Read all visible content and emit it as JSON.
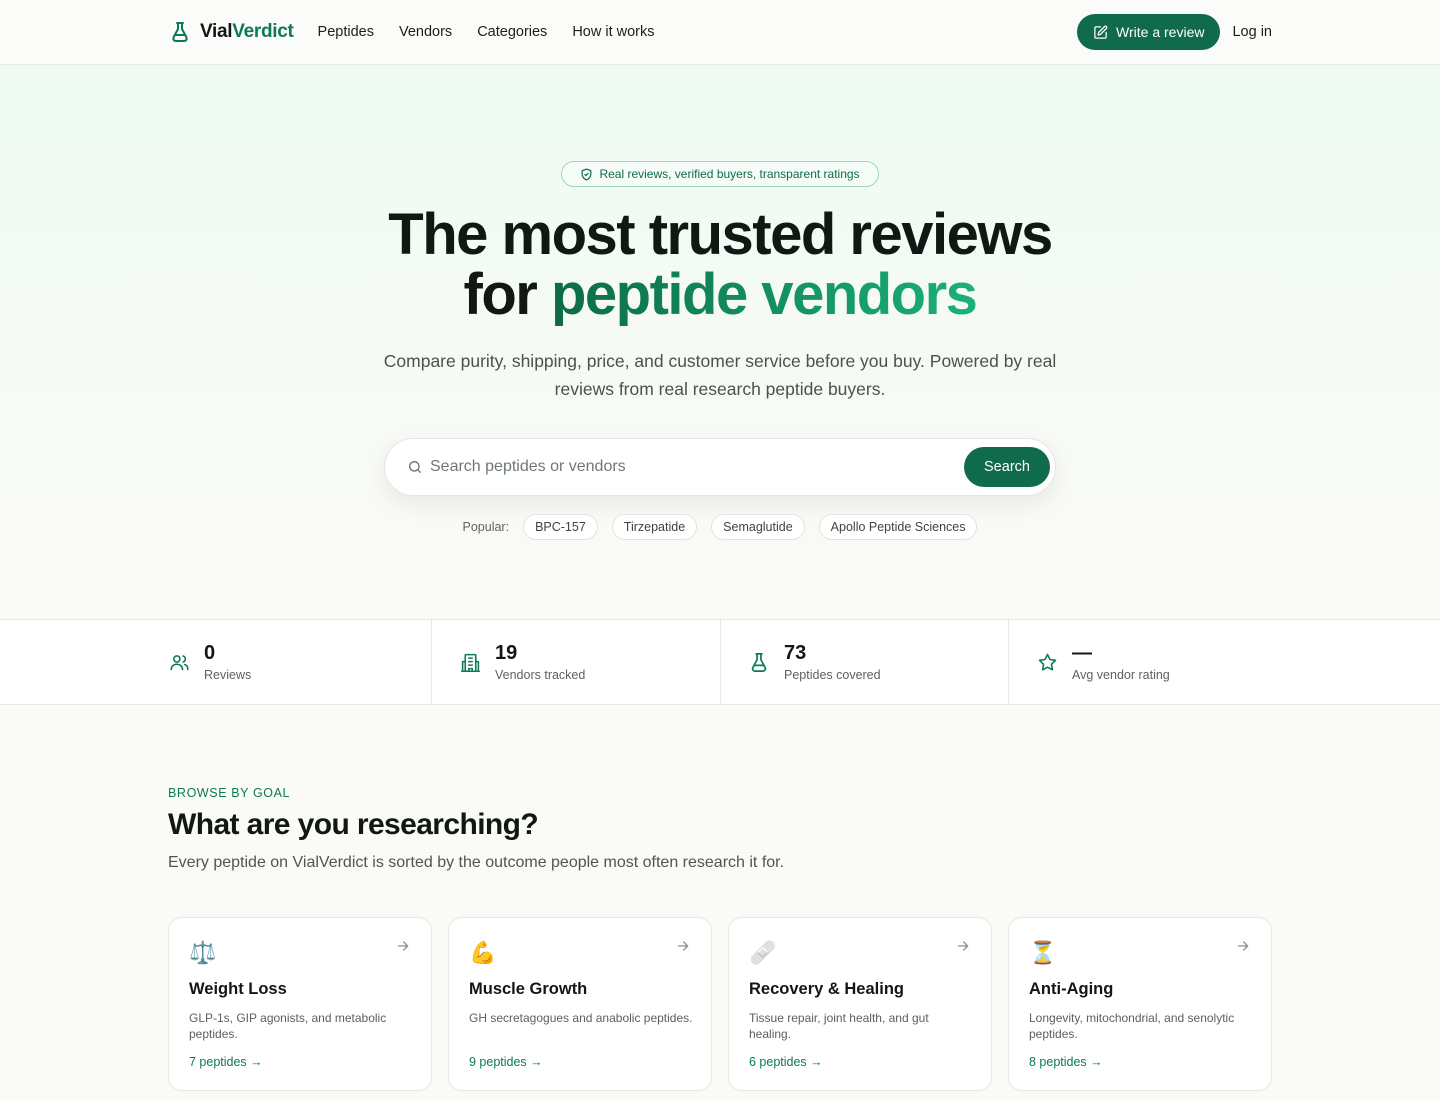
{
  "nav": {
    "logo_part1": "Vial",
    "logo_part2": "Verdict",
    "links": [
      "Peptides",
      "Vendors",
      "Categories",
      "How it works"
    ],
    "write_review": "Write a review",
    "login": "Log in"
  },
  "hero": {
    "badge": "Real reviews, verified buyers, transparent ratings",
    "title_line1": "The most trusted reviews",
    "title_line2_prefix": "for ",
    "title_line2_accent": "peptide vendors",
    "subtitle": "Compare purity, shipping, price, and customer service before you buy. Powered by real reviews from real research peptide buyers.",
    "search_placeholder": "Search peptides or vendors",
    "search_button": "Search",
    "popular_label": "Popular:",
    "popular_chips": [
      "BPC-157",
      "Tirzepatide",
      "Semaglutide",
      "Apollo Peptide Sciences"
    ]
  },
  "stats": [
    {
      "icon": "users-icon",
      "value": "0",
      "label": "Reviews"
    },
    {
      "icon": "building-icon",
      "value": "19",
      "label": "Vendors tracked"
    },
    {
      "icon": "flask-icon",
      "value": "73",
      "label": "Peptides covered"
    },
    {
      "icon": "star-icon",
      "value": "—",
      "label": "Avg vendor rating"
    }
  ],
  "browse": {
    "eyebrow": "BROWSE BY GOAL",
    "title": "What are you researching?",
    "subtitle": "Every peptide on VialVerdict is sorted by the outcome people most often research it for.",
    "cards": [
      {
        "emoji": "⚖️",
        "title": "Weight Loss",
        "desc": "GLP-1s, GIP agonists, and metabolic peptides.",
        "link": "7 peptides →"
      },
      {
        "emoji": "💪",
        "title": "Muscle Growth",
        "desc": "GH secretagogues and anabolic peptides.",
        "link": "9 peptides →"
      },
      {
        "emoji": "🩹",
        "title": "Recovery & Healing",
        "desc": "Tissue repair, joint health, and gut healing.",
        "link": "6 peptides →"
      },
      {
        "emoji": "⏳",
        "title": "Anti-Aging",
        "desc": "Longevity, mitochondrial, and senolytic peptides.",
        "link": "8 peptides →"
      }
    ]
  },
  "colors": {
    "brand_green": "#0f6b4b",
    "accent_green": "#1bb07a",
    "text_dark": "#111814"
  }
}
